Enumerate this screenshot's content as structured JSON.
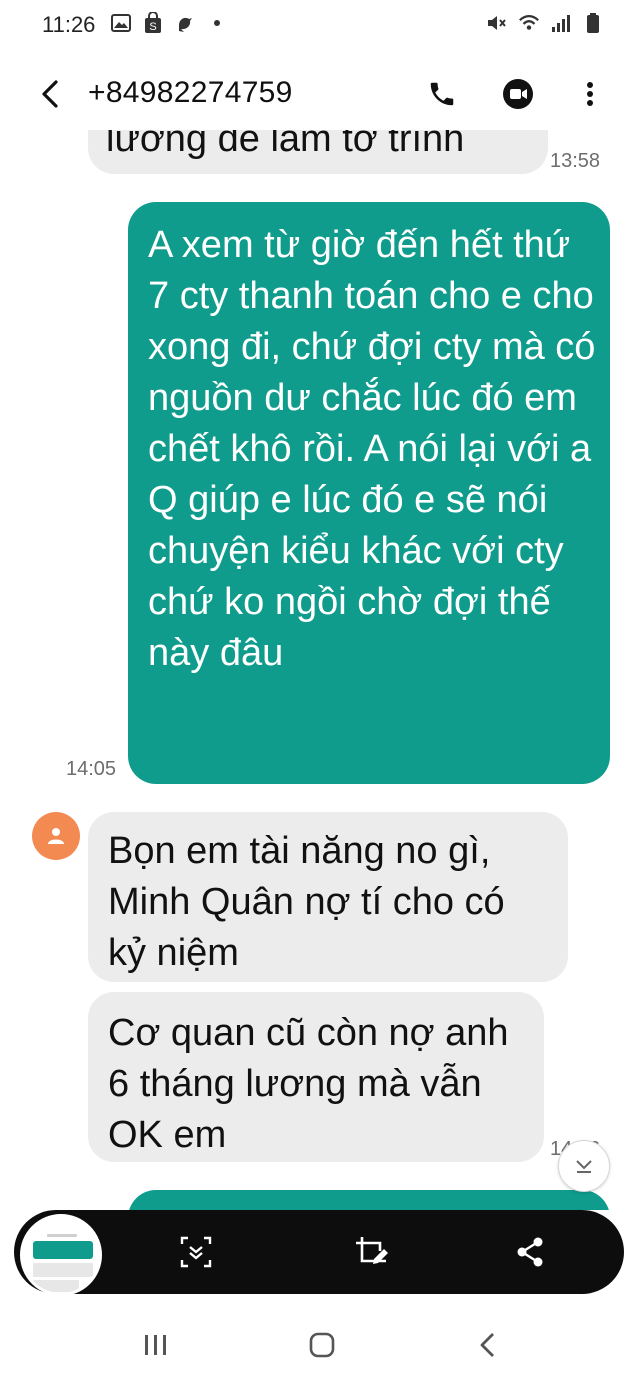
{
  "status_bar": {
    "time": "11:26",
    "left_icons": [
      "gallery-icon",
      "shopping-bag-icon",
      "bird-icon",
      "dot-icon"
    ],
    "right_icons": [
      "mute-icon",
      "wifi-icon",
      "signal-icon",
      "battery-icon"
    ]
  },
  "header": {
    "contact": "+84982274759",
    "icons": [
      "back-arrow-icon",
      "phone-icon",
      "video-call-icon",
      "more-vert-icon"
    ]
  },
  "messages": [
    {
      "id": "m1",
      "direction": "incoming",
      "text": "lương để làm tờ trình",
      "time": "13:58"
    },
    {
      "id": "m2",
      "direction": "outgoing",
      "text": "A xem từ giờ đến hết thứ 7 cty thanh toán cho e cho xong đi, chứ đợi cty mà có nguồn dư chắc lúc đó em chết khô rồi. A nói lại với a Q giúp e lúc đó e sẽ nói chuyện kiểu khác với cty chứ ko ngồi chờ đợi thế này đâu",
      "time": "14:05"
    },
    {
      "id": "m3",
      "direction": "incoming",
      "text": "Bọn em tài năng no gì, Minh Quân nợ tí cho có kỷ niệm"
    },
    {
      "id": "m4",
      "direction": "incoming",
      "text": "Cơ quan cũ còn nợ anh 6 tháng lương mà vẫn OK em",
      "time": "14:06"
    }
  ],
  "colors": {
    "outgoing_bubble": "#0f9c8c",
    "incoming_bubble": "#ececec",
    "avatar": "#f28a52",
    "share_bar": "#0d0d0d"
  },
  "screenshot_toolbar": {
    "icons": [
      "screenshot-thumbnail",
      "scroll-capture-icon",
      "crop-edit-icon",
      "share-icon"
    ]
  },
  "nav_bar": {
    "icons": [
      "recent-apps-icon",
      "home-icon",
      "back-nav-icon"
    ]
  }
}
